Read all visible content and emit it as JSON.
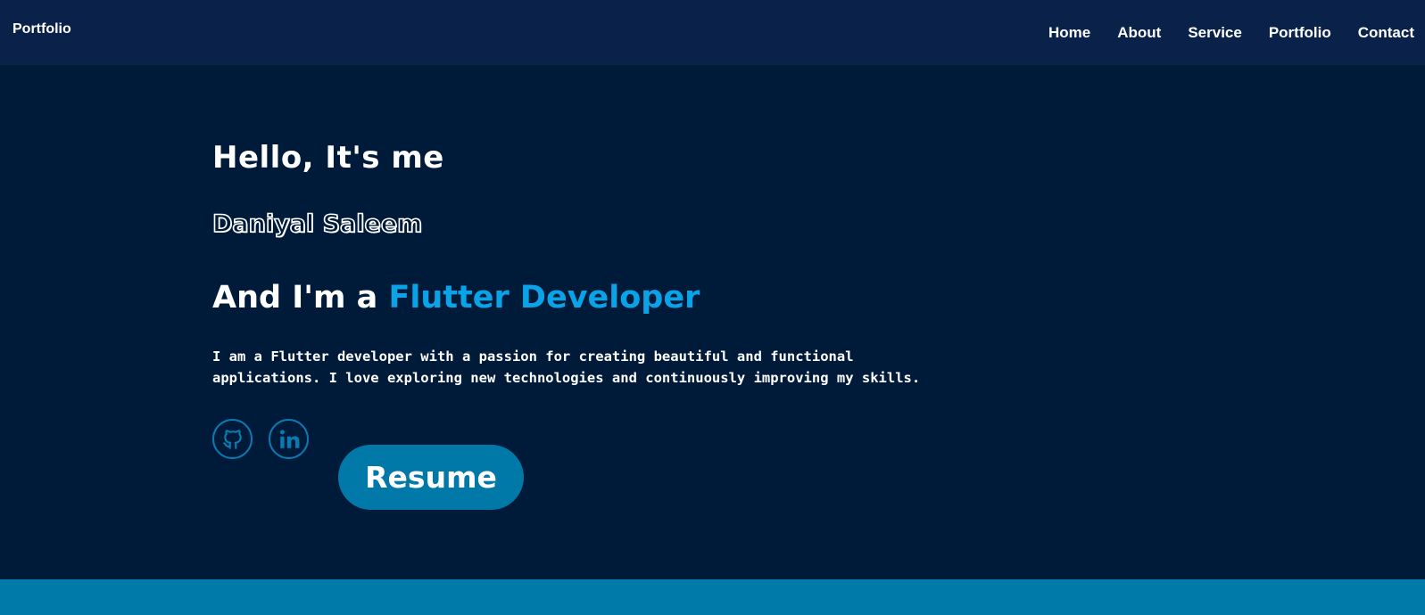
{
  "navbar": {
    "brand": "Portfolio",
    "links": [
      "Home",
      "About",
      "Service",
      "Portfolio",
      "Contact"
    ]
  },
  "hero": {
    "greeting": "Hello, It's me",
    "name": "Daniyal Saleem",
    "role_prefix": "And I'm a ",
    "role_highlight": "Flutter Developer",
    "bio": "I am a Flutter developer with a passion for creating beautiful and functional applications. I love exploring new technologies and continuously improving my skills.",
    "resume_label": "Resume"
  },
  "icons": {
    "github": "github-icon",
    "linkedin": "linkedin-icon"
  },
  "colors": {
    "nav_background": "#0a2249",
    "page_background": "#001b3a",
    "accent": "#0aa3e8",
    "button": "#0078a8",
    "icon_stroke": "#0a7ab0",
    "footer_band": "#007aa8"
  }
}
